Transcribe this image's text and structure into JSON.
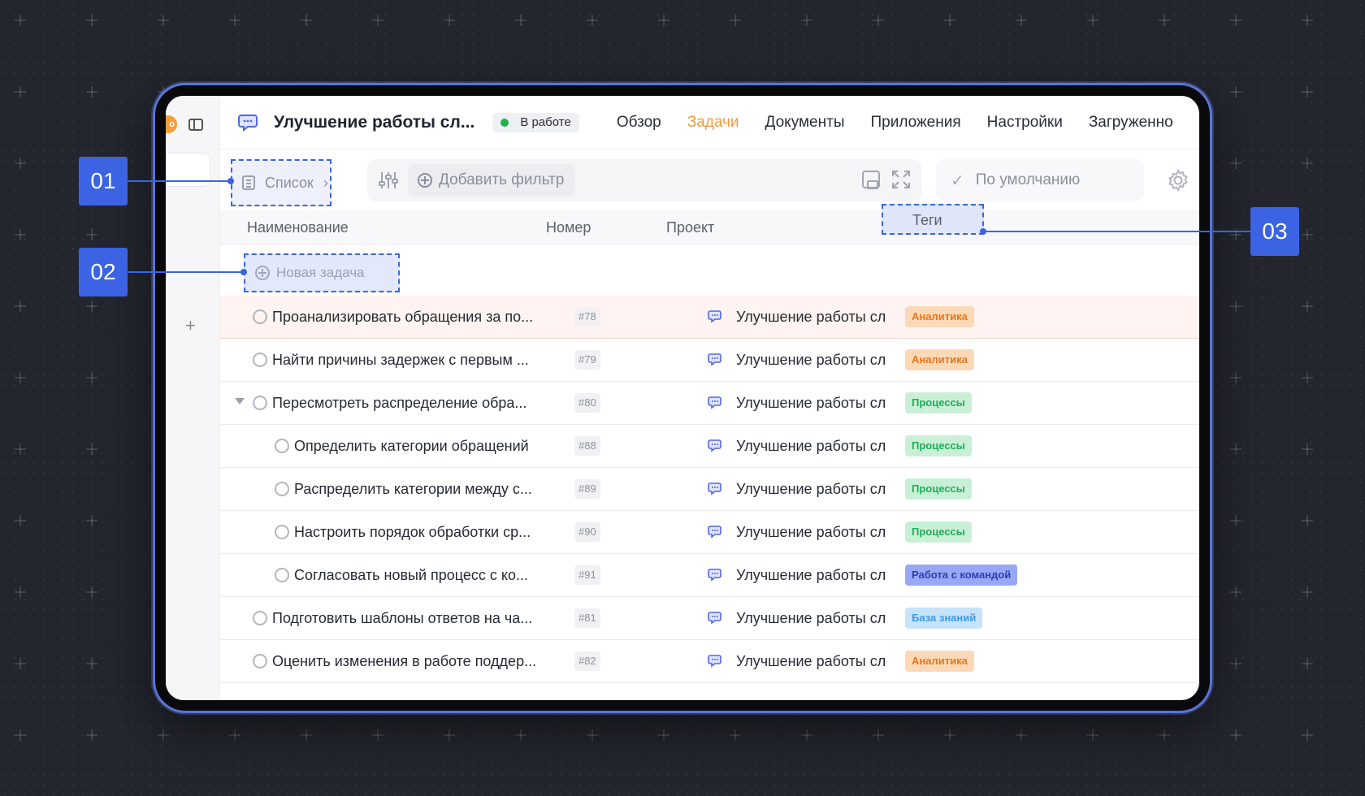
{
  "header": {
    "title": "Улучшение работы сл...",
    "status": "В работе",
    "tabs": [
      {
        "label": "Обзор"
      },
      {
        "label": "Задачи",
        "active": true
      },
      {
        "label": "Документы"
      },
      {
        "label": "Приложения"
      },
      {
        "label": "Настройки"
      },
      {
        "label": "Загруженно"
      }
    ]
  },
  "toolbar": {
    "view_label": "Список",
    "add_filter_label": "Добавить фильтр",
    "sort_label": "По умолчанию"
  },
  "table": {
    "columns": [
      "Наименование",
      "Номер",
      "Проект",
      "Теги"
    ],
    "new_task_label": "Новая задача",
    "rows": [
      {
        "name": "Проанализировать обращения за по...",
        "num": "#78",
        "project": "Улучшение работы сл",
        "tag": "Аналитика",
        "tag_kind": "orange",
        "level": 0,
        "highlighted": true
      },
      {
        "name": "Найти причины задержек с первым ...",
        "num": "#79",
        "project": "Улучшение работы сл",
        "tag": "Аналитика",
        "tag_kind": "orange",
        "level": 0
      },
      {
        "name": "Пересмотреть распределение обра...",
        "num": "#80",
        "project": "Улучшение работы сл",
        "tag": "Процессы",
        "tag_kind": "green",
        "level": 0,
        "expanded": true
      },
      {
        "name": "Определить категории обращений",
        "num": "#88",
        "project": "Улучшение работы сл",
        "tag": "Процессы",
        "tag_kind": "green",
        "level": 1
      },
      {
        "name": "Распределить категории между с...",
        "num": "#89",
        "project": "Улучшение работы сл",
        "tag": "Процессы",
        "tag_kind": "green",
        "level": 1
      },
      {
        "name": "Настроить порядок обработки ср...",
        "num": "#90",
        "project": "Улучшение работы сл",
        "tag": "Процессы",
        "tag_kind": "green",
        "level": 1
      },
      {
        "name": "Согласовать новый процесс с ко...",
        "num": "#91",
        "project": "Улучшение работы сл",
        "tag": "Работа с командой",
        "tag_kind": "blue",
        "level": 1
      },
      {
        "name": "Подготовить шаблоны ответов на ча...",
        "num": "#81",
        "project": "Улучшение работы сл",
        "tag": "База знаний",
        "tag_kind": "lightblue",
        "level": 0
      },
      {
        "name": "Оценить изменения в работе поддер...",
        "num": "#82",
        "project": "Улучшение работы сл",
        "tag": "Аналитика",
        "tag_kind": "orange",
        "level": 0
      }
    ]
  },
  "callouts": [
    "01",
    "02",
    "03"
  ],
  "colors": {
    "accent": "#3b63e3",
    "active_tab": "#f19a3e",
    "status_dot": "#21b24b",
    "tag_orange_bg": "#fcd9b6",
    "tag_orange_fg": "#e8761d",
    "tag_green_bg": "#c9f0d6",
    "tag_green_fg": "#1fae58",
    "tag_blue_bg": "#97a8f7",
    "tag_blue_fg": "#2a3fb4",
    "tag_lightblue_bg": "#c6e3fb",
    "tag_lightblue_fg": "#3c9ae4"
  },
  "icons": {
    "project": "chat-bubbles-icon",
    "view": "list-icon",
    "filter": "sliders-icon",
    "save": "save-icon",
    "expand": "expand-icon",
    "settings": "gear-icon",
    "sort_check": "check-icon"
  }
}
